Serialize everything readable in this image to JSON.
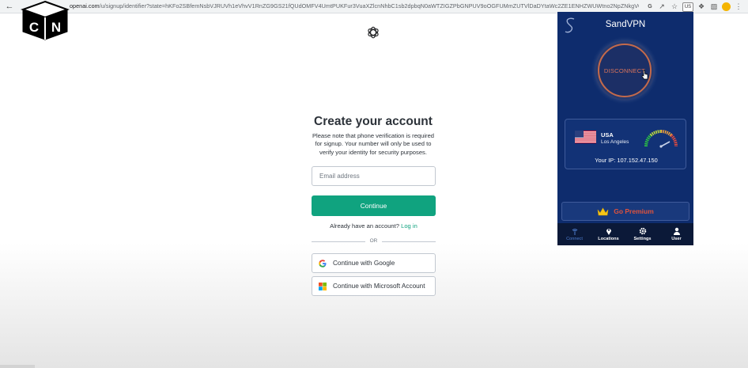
{
  "browser": {
    "back_icon": "arrow-left-icon",
    "url_host": "openai.com",
    "url_path": "/u/signup/identifier?state=hKFo2SBfemNsbVJRUVh1eVhvV1RnZG9GS21fQUdOMFV4UmtPUKFur3VuaXZlcnNhbC1sb2dpbqN0aWTZIGZPbGNPUV9oOGFUMmZUTVlDaDYtaWc2ZE1ENHZWUWtno2NpZNkgVGRKSWNiZTE2V29...",
    "extension_badge": "US",
    "icons": [
      "google-lens-icon",
      "share-icon",
      "star-icon",
      "extension-icon",
      "puzzle-icon",
      "profile-icon",
      "sidebar-icon",
      "menu-icon"
    ]
  },
  "logo": {
    "letters": [
      "C",
      "N"
    ]
  },
  "signup": {
    "title": "Create your account",
    "notice": "Please note that phone verification is required for signup. Your number will only be used to verify your identity for security purposes.",
    "email_placeholder": "Email address",
    "email_value": "",
    "continue_label": "Continue",
    "login_prompt": "Already have an account?",
    "login_link": "Log in",
    "divider_text": "OR",
    "google_label": "Continue with Google",
    "microsoft_label": "Continue with Microsoft Account",
    "accent_color": "#10a37f"
  },
  "vpn": {
    "app_name": "SandVPN",
    "disconnect_label": "DISCONNECT",
    "country": "USA",
    "city": "Los Angeles",
    "ip_text": "Your IP: 107.152.47.150",
    "premium_label": "Go Premium",
    "nav": [
      {
        "label": "Connect",
        "icon": "antenna-icon",
        "active": true
      },
      {
        "label": "Locations",
        "icon": "map-pin-icon",
        "active": false
      },
      {
        "label": "Settings",
        "icon": "gear-icon",
        "active": false
      },
      {
        "label": "User",
        "icon": "user-icon",
        "active": false
      }
    ],
    "colors": {
      "background": "#0e2c6d",
      "disconnect_ring": "#c46a4b",
      "premium_text": "#e0533c"
    }
  }
}
